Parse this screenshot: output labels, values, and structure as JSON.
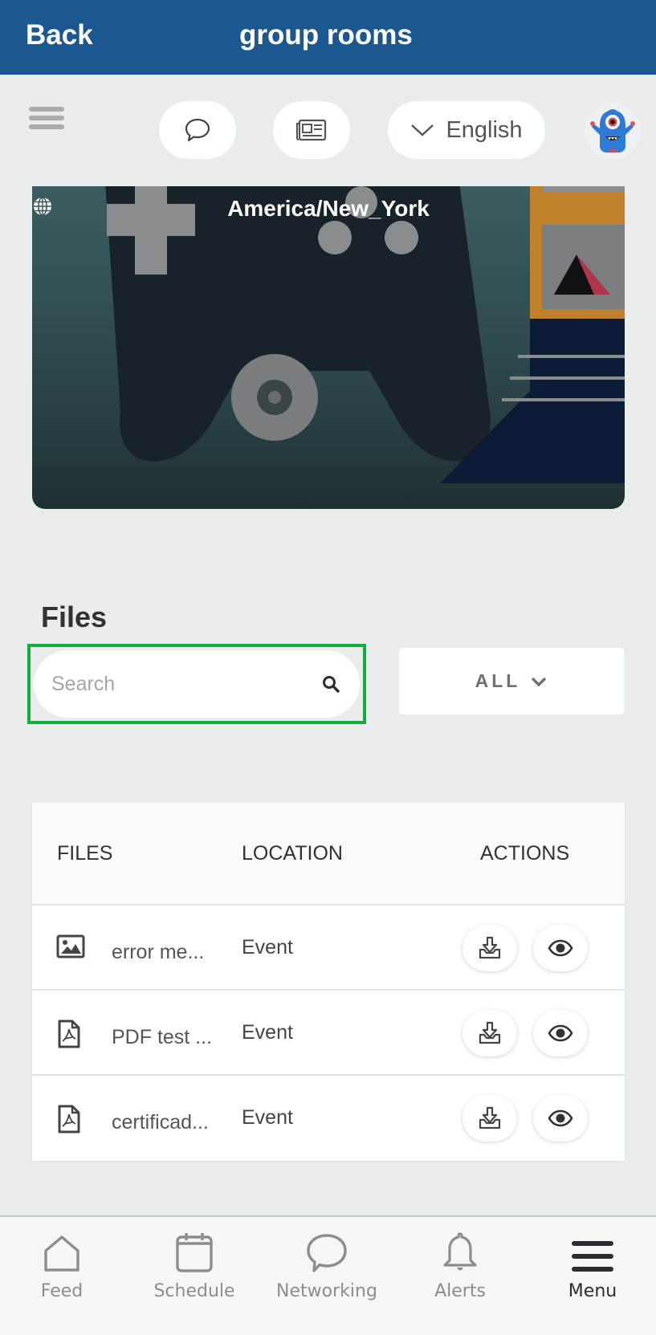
{
  "header": {
    "back_label": "Back",
    "title": "group rooms"
  },
  "toolbar": {
    "language": "English"
  },
  "banner": {
    "timezone": "America/New_York"
  },
  "files": {
    "heading": "Files",
    "search_placeholder": "Search",
    "search_value": "",
    "filter_label": "ALL",
    "columns": [
      "FILES",
      "LOCATION",
      "ACTIONS"
    ],
    "rows": [
      {
        "type": "image",
        "name": "error me...",
        "location": "Event"
      },
      {
        "type": "pdf",
        "name": "PDF test ...",
        "location": "Event"
      },
      {
        "type": "pdf",
        "name": "certificad...",
        "location": "Event"
      }
    ]
  },
  "tabbar": {
    "items": [
      {
        "label": "Feed",
        "icon": "home-icon"
      },
      {
        "label": "Schedule",
        "icon": "calendar-icon"
      },
      {
        "label": "Networking",
        "icon": "chat-bubble-icon"
      },
      {
        "label": "Alerts",
        "icon": "bell-icon"
      },
      {
        "label": "Menu",
        "icon": "menu-icon",
        "active": true
      }
    ]
  },
  "colors": {
    "header_bg": "#1c5890",
    "focus_outline": "#12ac3e",
    "page_bg": "#e8eced"
  }
}
